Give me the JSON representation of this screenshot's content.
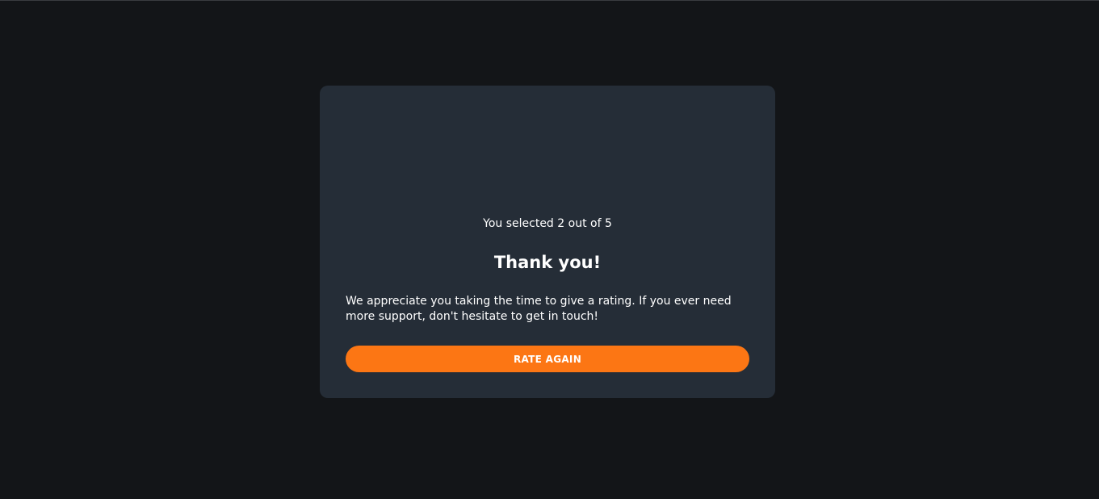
{
  "colors": {
    "page_background": "#131518",
    "card_background": "#252d37",
    "accent": "#fc7614",
    "text": "#ffffff"
  },
  "illustration": {
    "icon": "phone-payment-receipt-illustration"
  },
  "rating": {
    "selected_text": "You selected 2 out of 5",
    "selected_value": 2,
    "max_value": 5
  },
  "thankyou": {
    "title": "Thank you!",
    "message": "We appreciate you taking the time to give a rating. If you ever need more support, don't hesitate to get in touch!"
  },
  "actions": {
    "rate_again_label": "RATE AGAIN"
  }
}
